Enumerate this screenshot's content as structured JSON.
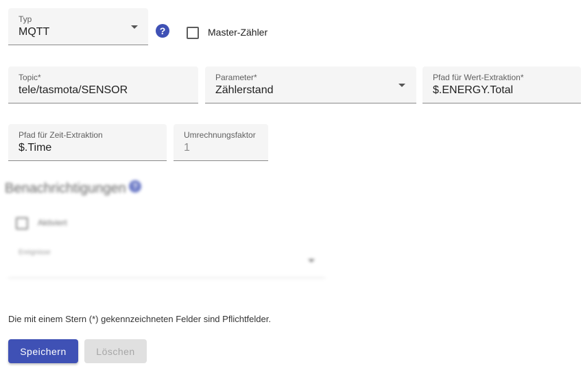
{
  "type_field": {
    "label": "Typ",
    "value": "MQTT"
  },
  "help_icon_glyph": "?",
  "master_counter": {
    "label": "Master-Zähler",
    "checked": false
  },
  "topic": {
    "label": "Topic*",
    "value": "tele/tasmota/SENSOR"
  },
  "parameter": {
    "label": "Parameter*",
    "value": "Zählerstand"
  },
  "value_path": {
    "label": "Pfad für Wert-Extraktion*",
    "value": "$.ENERGY.Total"
  },
  "time_path": {
    "label": "Pfad für Zeit-Extraktion",
    "value": "$.Time"
  },
  "conversion_factor": {
    "label": "Umrechnungsfaktor",
    "value": "1"
  },
  "notifications": {
    "heading": "Benachrichtigungen",
    "enabled_label": "Aktiviert",
    "enabled_checked": false,
    "events_label": "Ereignisse"
  },
  "required_note": "Die mit einem Stern (*) gekennzeichneten Felder sind Pflichtfelder.",
  "buttons": {
    "save": "Speichern",
    "delete": "Löschen"
  },
  "colors": {
    "primary": "#3f51b5",
    "field_bg": "#f5f5f5",
    "disabled_bg": "#e0e0e0"
  }
}
